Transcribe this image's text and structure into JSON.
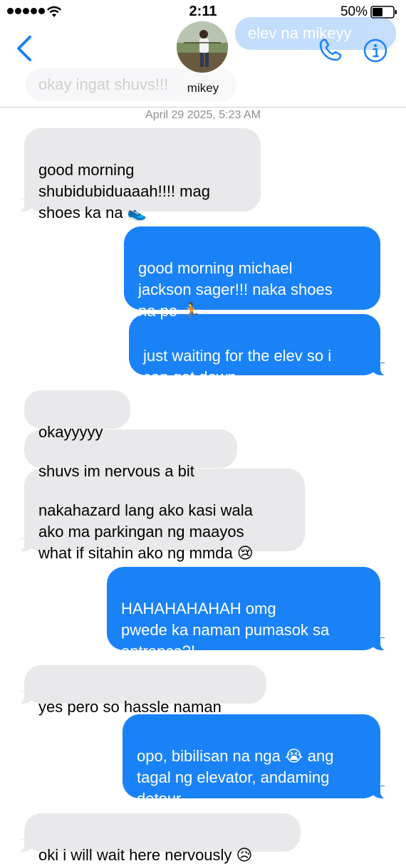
{
  "status_bar": {
    "time": "2:11",
    "battery": "50%",
    "signal_bars": 5
  },
  "header": {
    "contact_name": "mikey",
    "ghost_sent": "elev na mikeyy",
    "ghost_received": "okay ingat shuvs!!!",
    "icons": [
      "back-chevron-icon",
      "phone-icon",
      "info-icon"
    ],
    "accent_color": "#1a82f7"
  },
  "thread": {
    "timestamp": "April 29 2025, 5:23 AM",
    "messages": [
      {
        "dir": "received",
        "text": "good morning\nshubidubiduaaah!!!! mag\nshoes ka na 👟"
      },
      {
        "dir": "sent",
        "text": "good morning michael\njackson sager!!! naka shoes\nna po 🏃"
      },
      {
        "dir": "sent",
        "text": "just waiting for the elev so i\ncan get down"
      },
      {
        "dir": "received",
        "text": "okayyyyy"
      },
      {
        "dir": "received",
        "text": "shuvs im nervous a bit"
      },
      {
        "dir": "received",
        "text": "nakahazard lang ako kasi wala\nako ma parkingan ng maayos\nwhat if sitahin ako ng mmda 😢"
      },
      {
        "dir": "sent",
        "text": "HAHAHAHAHAH omg\npwede ka naman pumasok sa\nentrance?!"
      },
      {
        "dir": "received",
        "text": "yes pero so hassle naman"
      },
      {
        "dir": "sent",
        "text": "opo, bibilisan na nga 😭 ang\ntagal ng elevator, andaming\ndetour"
      },
      {
        "dir": "received",
        "text": "oki i will wait here nervously 😥"
      }
    ]
  }
}
